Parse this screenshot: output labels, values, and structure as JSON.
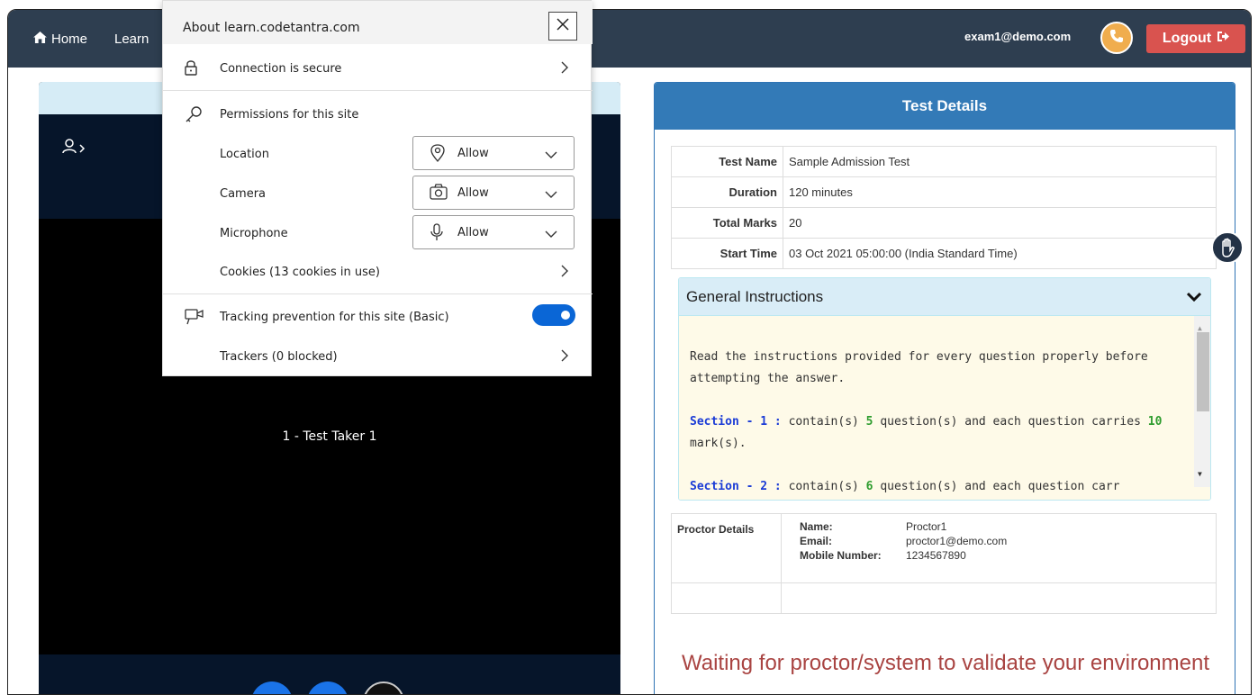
{
  "navbar": {
    "home_label": "Home",
    "learn_label": "Learn",
    "email": "exam1@demo.com",
    "logout_label": "Logout"
  },
  "video": {
    "participant_name": "1 - Test Taker 1"
  },
  "details": {
    "title": "Test Details",
    "rows": [
      {
        "label": "Test Name",
        "value": "Sample Admission Test"
      },
      {
        "label": "Duration",
        "value": "120 minutes"
      },
      {
        "label": "Total Marks",
        "value": "20"
      },
      {
        "label": "Start Time",
        "value": "03 Oct 2021 05:00:00 (India Standard Time)"
      }
    ],
    "instructions": {
      "heading": "General Instructions",
      "line1": "Read the instructions provided for every question properly before attempting the answer.",
      "section1_label": "Section - 1 :",
      "section1_pre": " contain(s) ",
      "section1_questions": "5",
      "section1_mid": " question(s) and each question carries ",
      "section1_marks": "10",
      "section1_post": "  mark(s).",
      "section2_label": "Section - 2 :",
      "section2_pre": " contain(s) ",
      "section2_questions": "6",
      "section2_mid": " question(s) and each question carr"
    },
    "proctor": {
      "label": "Proctor Details",
      "name_key": "Name:",
      "name_val": "Proctor1",
      "email_key": "Email:",
      "email_val": "proctor1@demo.com",
      "mobile_key": "Mobile Number:",
      "mobile_val": "1234567890"
    },
    "waiting": "Waiting for proctor/system to validate your environment"
  },
  "popup": {
    "title": "About learn.codetantra.com",
    "connection": "Connection is secure",
    "permissions_heading": "Permissions for this site",
    "location_label": "Location",
    "location_value": "Allow",
    "camera_label": "Camera",
    "camera_value": "Allow",
    "microphone_label": "Microphone",
    "microphone_value": "Allow",
    "cookies": "Cookies (13 cookies in use)",
    "tracking": "Tracking prevention for this site (Basic)",
    "trackers": "Trackers (0 blocked)",
    "tracking_enabled": true
  },
  "colors": {
    "navbar": "#2e3e50",
    "logout": "#d9534f",
    "phone": "#f0ad4e",
    "panel_header": "#337ab7",
    "toggle_on": "#0a66d6",
    "waiting_text": "#a94442"
  }
}
